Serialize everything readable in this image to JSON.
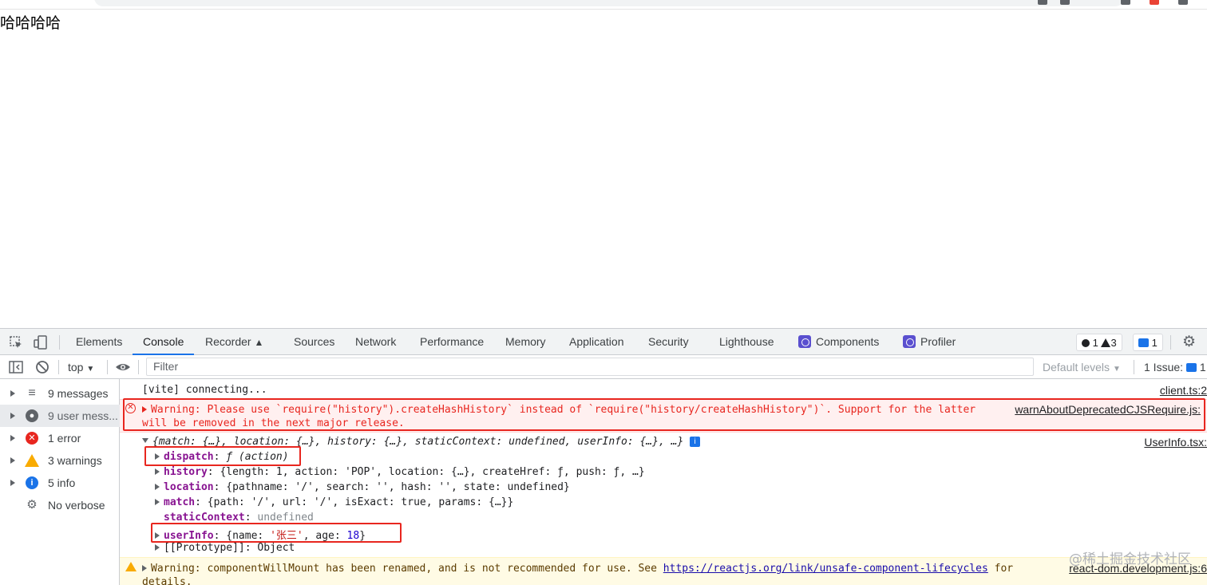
{
  "page": {
    "text": "哈哈哈哈"
  },
  "devtools": {
    "tabs": [
      {
        "label": "Elements"
      },
      {
        "label": "Console",
        "active": true
      },
      {
        "label": "Recorder"
      },
      {
        "label": "Sources"
      },
      {
        "label": "Network"
      },
      {
        "label": "Performance"
      },
      {
        "label": "Memory"
      },
      {
        "label": "Application"
      },
      {
        "label": "Security"
      },
      {
        "label": "Lighthouse"
      },
      {
        "label": "Components"
      },
      {
        "label": "Profiler"
      }
    ],
    "recorder_icon": "flask-icon",
    "counters": {
      "errors": "1",
      "warnings": "3",
      "messages": "1"
    },
    "toolbar": {
      "context": "top",
      "filter_placeholder": "Filter",
      "levels": "Default levels",
      "issues": "1 Issue:",
      "issues_count": "1"
    },
    "sidebar": [
      {
        "label": "9 messages",
        "icon": "list-icon"
      },
      {
        "label": "9 user mess...",
        "icon": "user-icon",
        "active": true
      },
      {
        "label": "1 error",
        "icon": "error-icon"
      },
      {
        "label": "3 warnings",
        "icon": "warning-icon"
      },
      {
        "label": "5 info",
        "icon": "info-icon"
      },
      {
        "label": "No verbose",
        "icon": "bug-icon"
      }
    ],
    "console": {
      "vite_msg": "[vite] connecting...",
      "vite_src": "client.ts:2",
      "error_line1": "Warning: Please use `require(\"history\").createHashHistory` instead of `require(\"history/createHashHistory\")`. Support for the latter",
      "error_line2": "will be removed in the next major release.",
      "error_src": "warnAboutDeprecatedCJSRequire.js:",
      "obj_summary": "{match: {…}, location: {…}, history: {…}, staticContext: undefined, userInfo: {…}, …}",
      "obj_src": "UserInfo.tsx:",
      "props": {
        "dispatch_key": "dispatch",
        "dispatch_val": "ƒ (action)",
        "history_key": "history",
        "history_val": "{length: 1, action: 'POP', location: {…}, createHref: ƒ, push: ƒ, …}",
        "location_key": "location",
        "location_val": "{pathname: '/', search: '', hash: '', state: undefined}",
        "match_key": "match",
        "match_val": "{path: '/', url: '/', isExact: true, params: {…}}",
        "static_key": "staticContext",
        "static_val": "undefined",
        "userinfo_key": "userInfo",
        "userinfo_val_a": "{name: ",
        "userinfo_name": "'张三'",
        "userinfo_val_b": ", age: ",
        "userinfo_age": "18",
        "userinfo_val_c": "}",
        "proto": "[[Prototype]]: Object"
      },
      "warn_text": "Warning: componentWillMount has been renamed, and is not recommended for use. See ",
      "warn_link": "https://reactjs.org/link/unsafe-component-lifecycles",
      "warn_text2": " for",
      "warn_line2": "details.",
      "warn_src": "react-dom.development.js:6"
    }
  },
  "watermark": "@稀土掘金技术社区",
  "colors": {
    "accent": "#1a73e8",
    "error": "#e8261f",
    "warning": "#f9ab00"
  }
}
